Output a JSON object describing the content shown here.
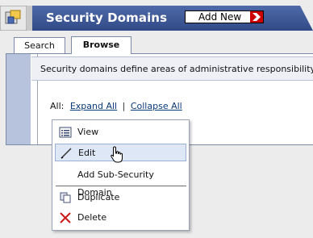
{
  "header": {
    "title": "Security Domains",
    "add_new_label": "Add New",
    "colors": {
      "bar": "#3d5a99",
      "bar_dark": "#2e467a",
      "accent": "#cc0000"
    }
  },
  "tabs": [
    {
      "label": "Search",
      "active": false
    },
    {
      "label": "Browse",
      "active": true
    }
  ],
  "description": "Security domains define areas of administrative responsibility. Brows",
  "tree_controls": {
    "all_label": "All:",
    "expand_all": "Expand All",
    "separator": "|",
    "collapse_all": "Collapse All"
  },
  "context_menu": {
    "items": [
      {
        "label": "View",
        "icon": "list-view-icon",
        "hovered": false
      },
      {
        "label": "Edit",
        "icon": "pencil-icon",
        "hovered": true
      },
      {
        "label": "Add Sub-Security Domain",
        "icon": "",
        "hovered": false
      },
      {
        "label": "Duplicate",
        "icon": "duplicate-icon",
        "hovered": false
      },
      {
        "label": "Delete",
        "icon": "delete-x-icon",
        "hovered": false
      }
    ]
  },
  "cursor": "hand-pointer-icon"
}
